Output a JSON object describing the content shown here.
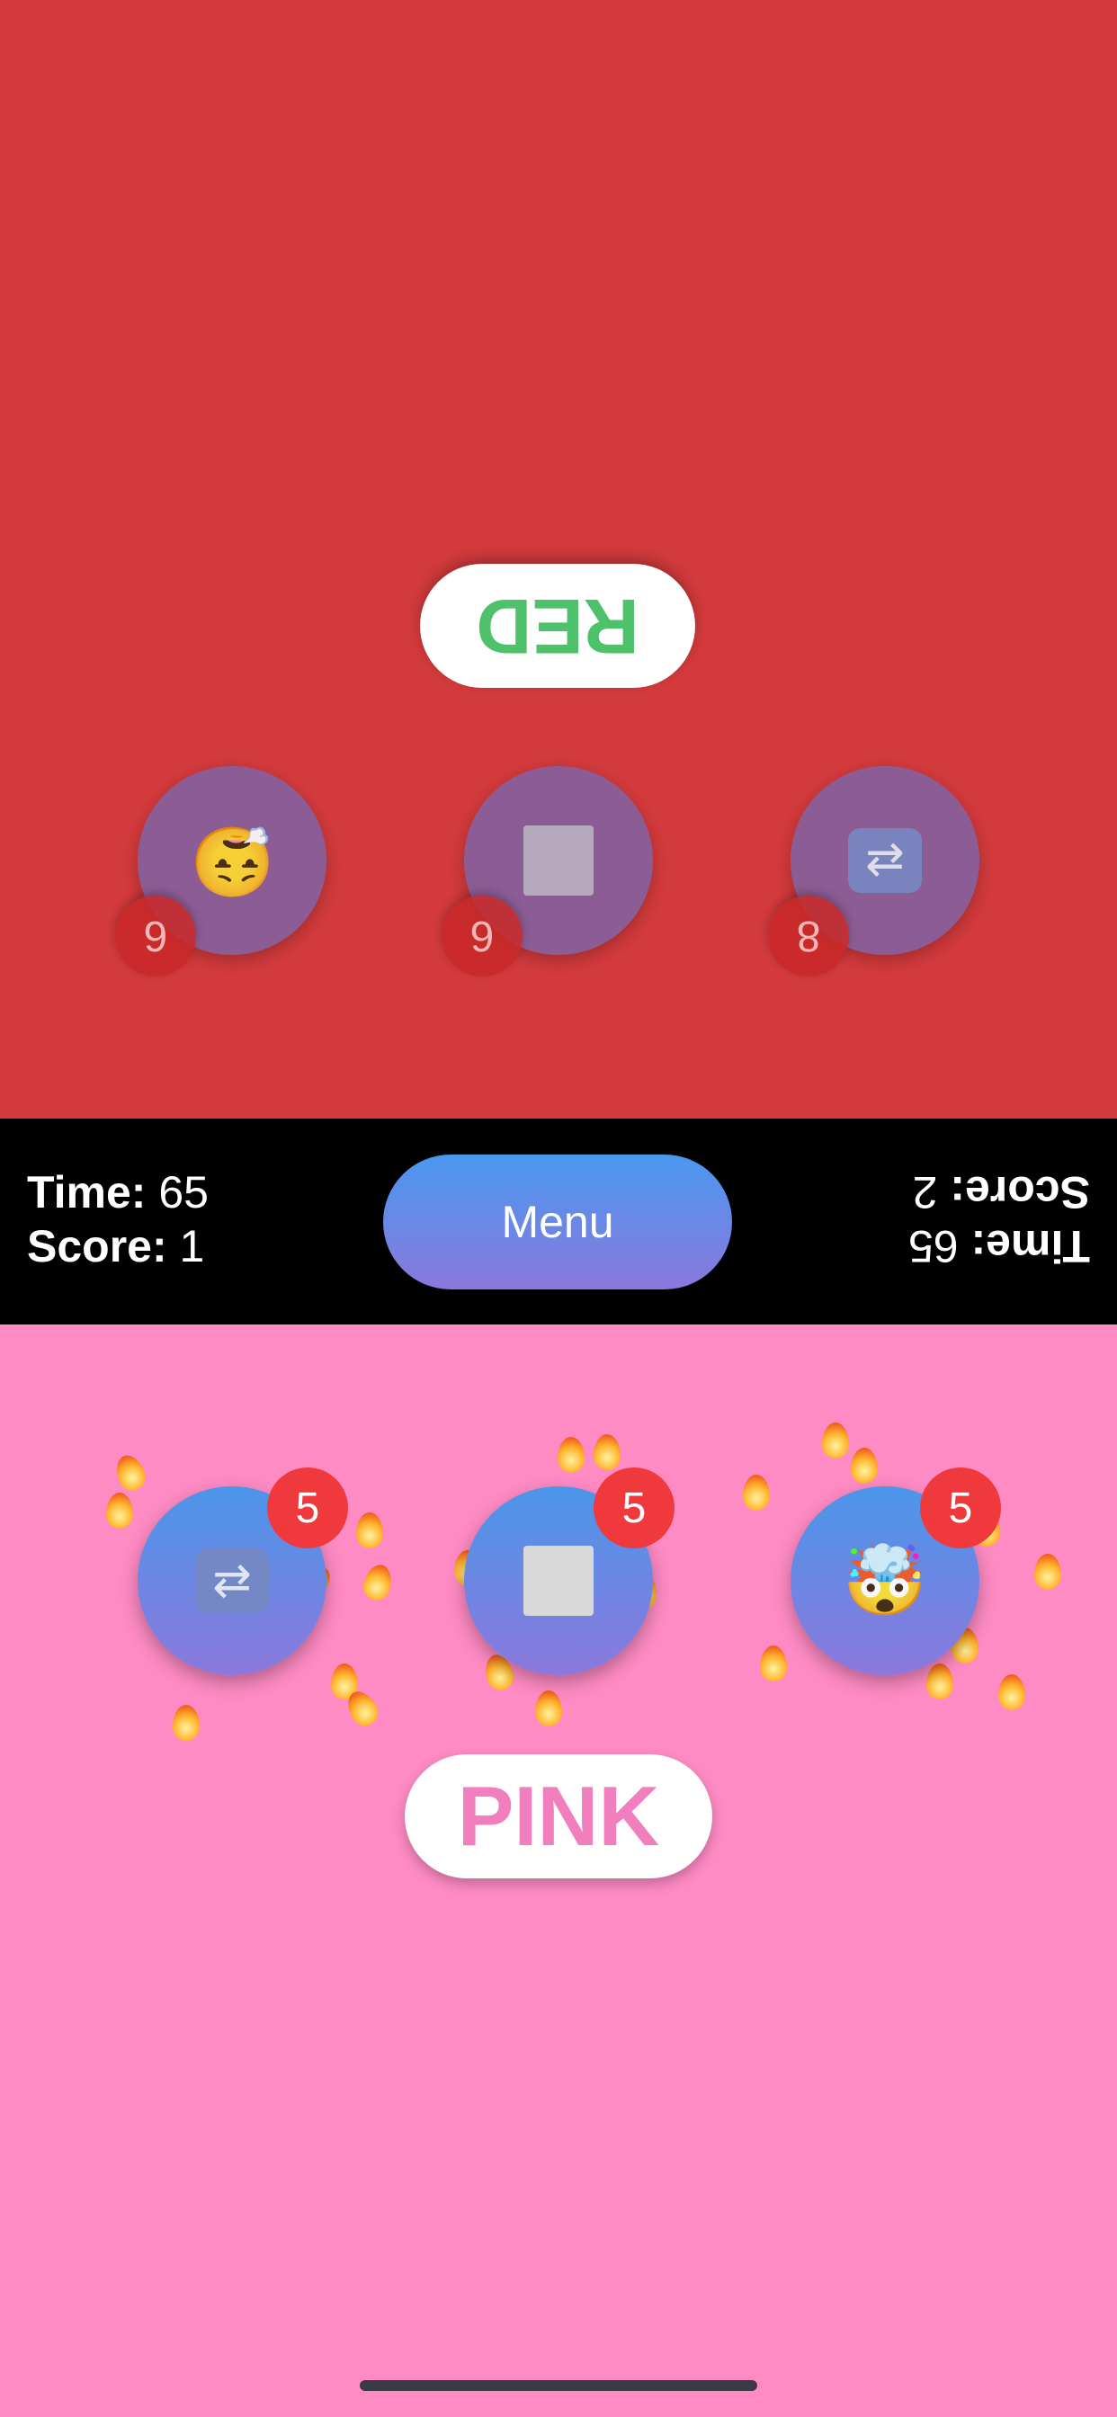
{
  "colors": {
    "top_background": "#d33a3c",
    "bottom_background": "#ff8bc4",
    "middle_bar": "#000000",
    "top_word_color": "#4ec26a",
    "bottom_word_color": "#f27fbd"
  },
  "top_player": {
    "word": "RED",
    "buttons": [
      {
        "icon": "face-exhaling-icon",
        "glyph": "😮‍💨",
        "count": "6"
      },
      {
        "icon": "stop-square-icon",
        "glyph": "",
        "count": "6"
      },
      {
        "icon": "shuffle-icon",
        "glyph": "🔀",
        "count": "8"
      }
    ]
  },
  "bottom_player": {
    "word": "PINK",
    "buttons": [
      {
        "icon": "shuffle-icon",
        "glyph": "🔀",
        "count": "5"
      },
      {
        "icon": "stop-square-icon",
        "glyph": "",
        "count": "5"
      },
      {
        "icon": "exploding-head-icon",
        "glyph": "🤯",
        "count": "5"
      }
    ]
  },
  "hud": {
    "left": {
      "time_label": "Time:",
      "time_value": "65",
      "score_label": "Score:",
      "score_value": "1"
    },
    "right": {
      "time_label": "Time:",
      "time_value": "65",
      "score_label": "Score:",
      "score_value": "2"
    },
    "menu_label": "Menu"
  }
}
